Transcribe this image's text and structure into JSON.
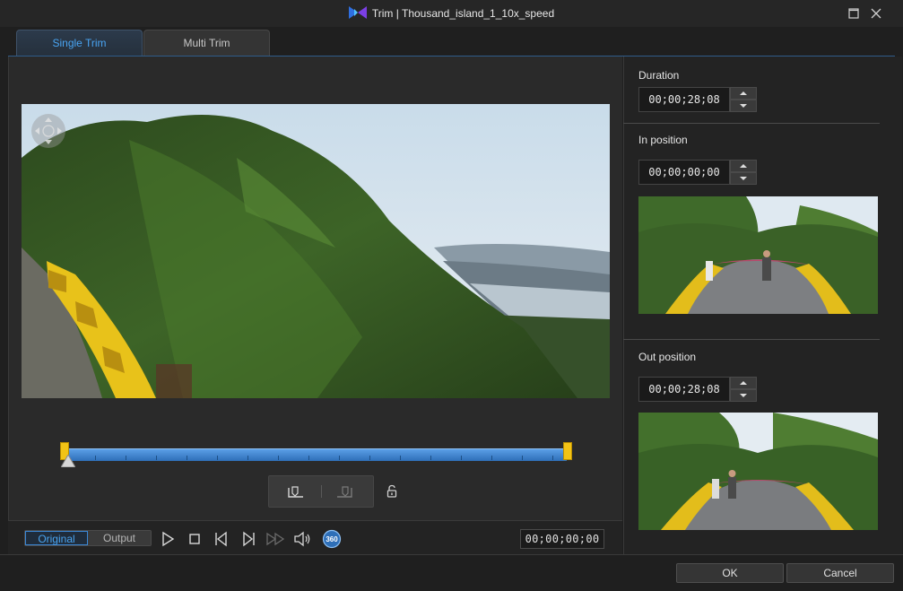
{
  "window": {
    "title": "Trim | Thousand_island_1_10x_speed",
    "accent": "#49a4f2"
  },
  "tabs": [
    {
      "label": "Single Trim",
      "active": true
    },
    {
      "label": "Multi Trim",
      "active": false
    }
  ],
  "preview": {
    "content": "360 video frame - forest hillside with yellow guardrail overlooking lake",
    "timeline": {
      "in_fraction": 0.0,
      "out_fraction": 1.0,
      "playhead_fraction": 0.0
    }
  },
  "view_toggle": {
    "original_label": "Original",
    "output_label": "Output",
    "selected": "Original"
  },
  "playback": {
    "controls": [
      "play-icon",
      "stop-icon",
      "prev-frame-icon",
      "next-frame-icon",
      "fast-forward-icon",
      "volume-icon",
      "360-icon"
    ],
    "badge_360": "360",
    "current_time": "00;00;00;00"
  },
  "right_panel": {
    "duration": {
      "label": "Duration",
      "value": "00;00;28;08"
    },
    "in_position": {
      "label": "In position",
      "value": "00;00;00;00"
    },
    "out_position": {
      "label": "Out position",
      "value": "00;00;28;08"
    }
  },
  "footer": {
    "ok_label": "OK",
    "cancel_label": "Cancel"
  }
}
